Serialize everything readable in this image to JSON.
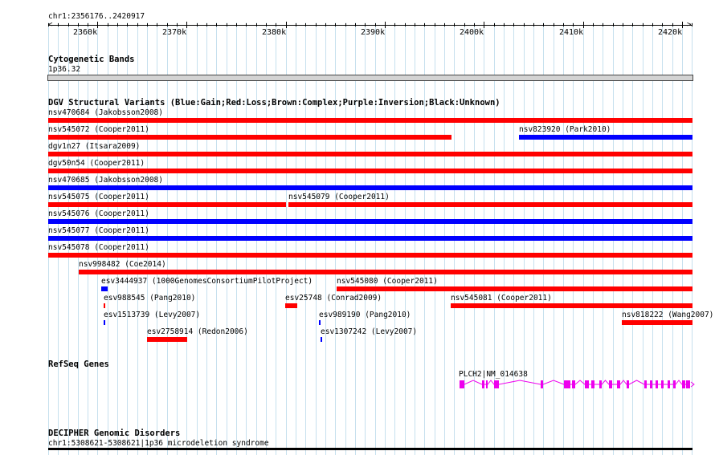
{
  "ruler": {
    "location": "chr1:2356176..2420917",
    "ticks": [
      "2360k",
      "2370k",
      "2380k",
      "2390k",
      "2400k",
      "2410k",
      "2420k"
    ]
  },
  "cytobands": {
    "title": "Cytogenetic Bands",
    "band": "1p36.32"
  },
  "dgv": {
    "title": "DGV Structural Variants (Blue:Gain;Red:Loss;Brown:Complex;Purple:Inversion;Black:Unknown)",
    "colors": {
      "gain": "#0000ff",
      "loss": "#ff0000"
    },
    "features": [
      {
        "name": "nsv470684 (Jakobsson2008)",
        "type": "loss"
      },
      {
        "name": "nsv545072 (Cooper2011)",
        "type": "loss"
      },
      {
        "name": "nsv823920 (Park2010)",
        "type": "gain"
      },
      {
        "name": "dgv1n27 (Itsara2009)",
        "type": "loss"
      },
      {
        "name": "dgv50n54 (Cooper2011)",
        "type": "loss"
      },
      {
        "name": "nsv470685 (Jakobsson2008)",
        "type": "gain"
      },
      {
        "name": "nsv545075 (Cooper2011)",
        "type": "loss"
      },
      {
        "name": "nsv545079 (Cooper2011)",
        "type": "loss"
      },
      {
        "name": "nsv545076 (Cooper2011)",
        "type": "gain"
      },
      {
        "name": "nsv545077 (Cooper2011)",
        "type": "gain"
      },
      {
        "name": "nsv545078 (Cooper2011)",
        "type": "loss"
      },
      {
        "name": "nsv998482 (Coe2014)",
        "type": "loss"
      },
      {
        "name": "esv3444937 (1000GenomesConsortiumPilotProject)",
        "type": "gain"
      },
      {
        "name": "nsv545080 (Cooper2011)",
        "type": "loss"
      },
      {
        "name": "esv988545 (Pang2010)",
        "type": "loss"
      },
      {
        "name": "esv25748 (Conrad2009)",
        "type": "loss"
      },
      {
        "name": "nsv545081 (Cooper2011)",
        "type": "loss"
      },
      {
        "name": "esv1513739 (Levy2007)",
        "type": "gain"
      },
      {
        "name": "esv989190 (Pang2010)",
        "type": "gain"
      },
      {
        "name": "nsv818222 (Wang2007)",
        "type": "loss"
      },
      {
        "name": "esv2758914 (Redon2006)",
        "type": "loss"
      },
      {
        "name": "esv1307242 (Levy2007)",
        "type": "gain"
      }
    ]
  },
  "refseq": {
    "title": "RefSeq Genes",
    "gene_label": "PLCH2|NM_014638",
    "color": "#ee00ee"
  },
  "decipher": {
    "title": "DECIPHER Genomic Disorders",
    "feature": "chr1:5308621-5308621|1p36 microdeletion syndrome"
  }
}
